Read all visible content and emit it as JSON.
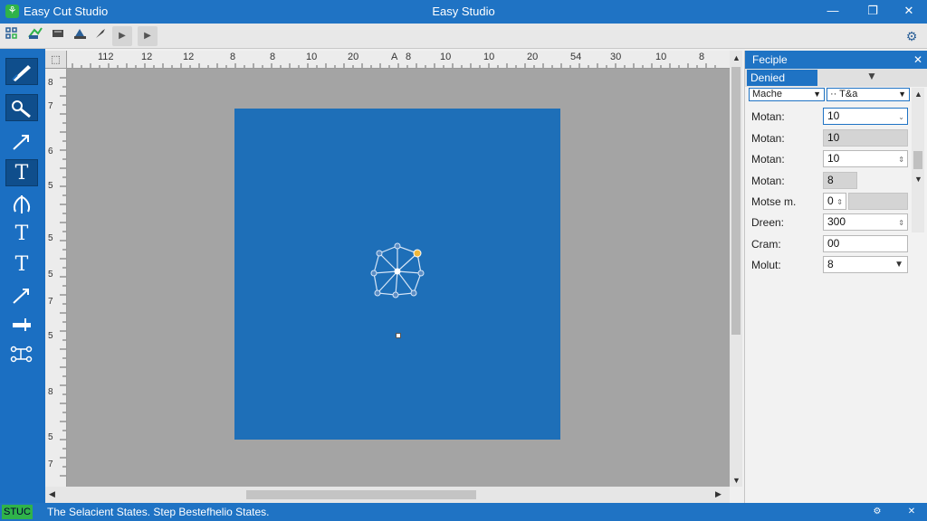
{
  "window": {
    "app_name": "Easy Cut Studio",
    "title": "Easy Studio",
    "logo_glyph": "⚘",
    "minimize": "—",
    "maximize": "❐",
    "close": "✕",
    "settings_glyph": "⚙"
  },
  "toolbar": {
    "items": [
      "grid-icon",
      "import-icon",
      "cut-icon",
      "print-icon",
      "knife-icon",
      "play-icon",
      "play-next-icon"
    ]
  },
  "left_tools": [
    "sketch-tool",
    "knife-tool",
    "arrow-tool",
    "text-tool",
    "curve-text-tool",
    "vertical-text-tool",
    "serif-text-tool",
    "line-tool",
    "split-tool",
    "node-tool"
  ],
  "ruler_top": {
    "corner": "⬚",
    "labels": [
      "112",
      "12",
      "12",
      "8",
      "8",
      "10",
      "20",
      "A",
      "8",
      "10",
      "10",
      "20",
      "54",
      "30",
      "10",
      "8"
    ]
  },
  "ruler_left": {
    "labels": [
      "8",
      "7",
      "6",
      "5",
      "5",
      "5",
      "7",
      "5",
      "8",
      "5",
      "7"
    ]
  },
  "panel": {
    "title": "Feciple",
    "close": "✕",
    "tab_label": "Denied",
    "tab_caret": "▼",
    "select1": "Mache",
    "select2": "·· T&a",
    "fields": [
      {
        "label": "Motan:",
        "value": "10"
      },
      {
        "label": "Motan:",
        "value": "10"
      },
      {
        "label": "Motan:",
        "value": "10"
      },
      {
        "label": "Motan:",
        "value": "8"
      },
      {
        "label": "Motse m.",
        "value": "0"
      },
      {
        "label": "Dreen:",
        "value": "300"
      },
      {
        "label": "Cram:",
        "value": "00"
      },
      {
        "label": "Molut:",
        "value": "8"
      }
    ]
  },
  "status": {
    "badge": "STUC",
    "text": "The Selacient States. Step Bestefhelio States.",
    "btn_a": "⚙",
    "btn_b": "✕"
  }
}
